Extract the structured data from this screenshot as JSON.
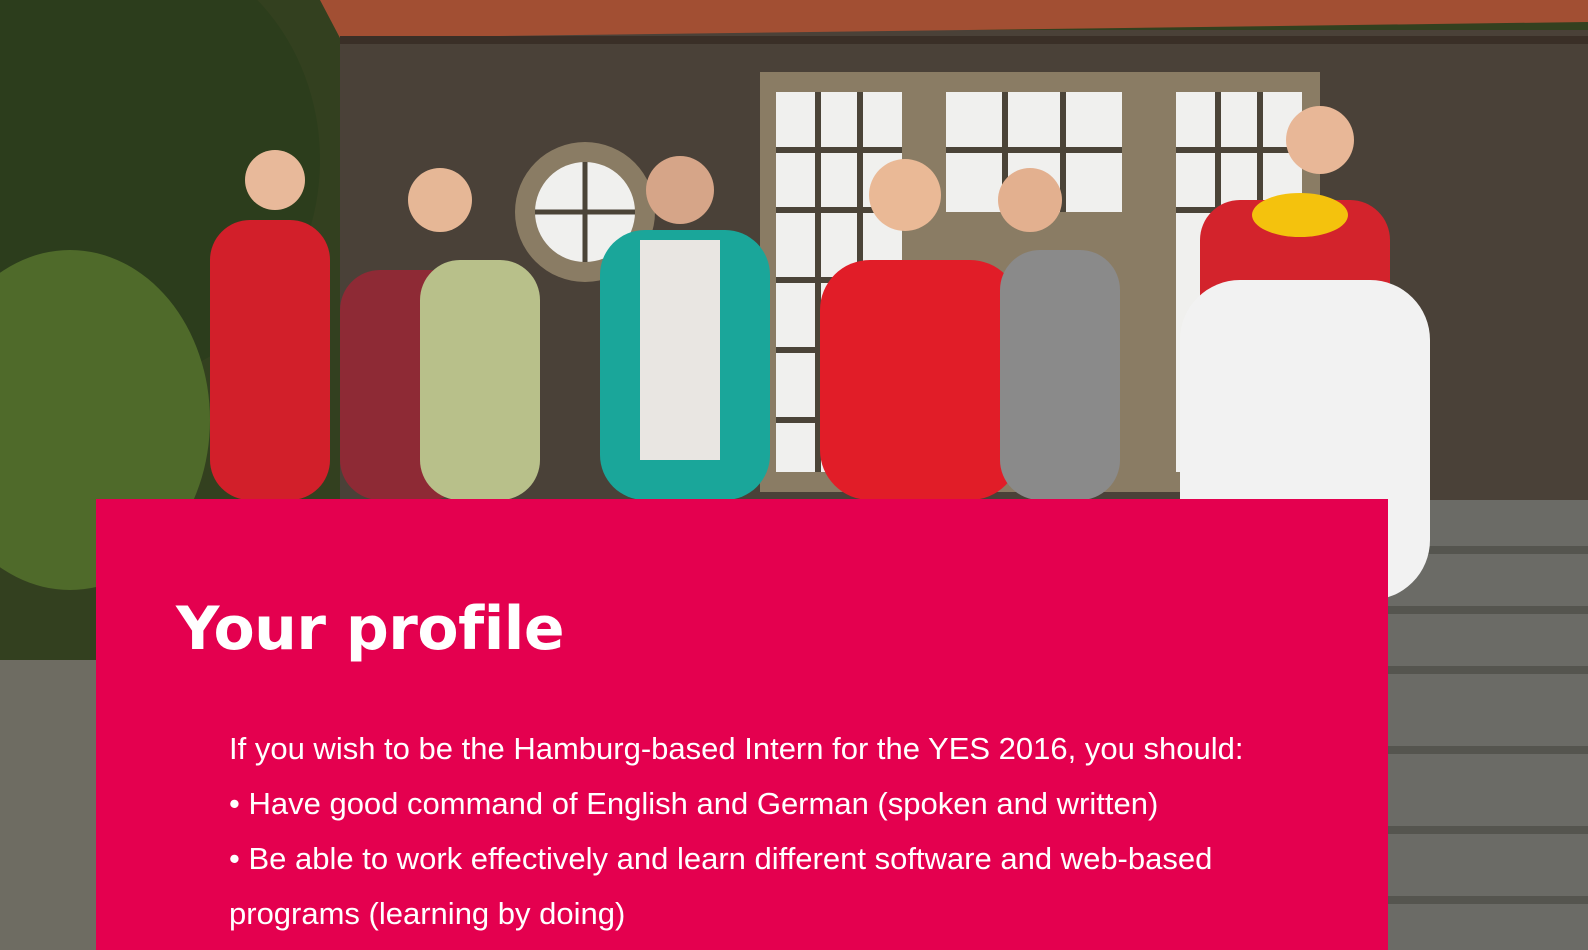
{
  "colors": {
    "card_background": "#e4004f",
    "text": "#ffffff"
  },
  "hero": {
    "image": "group-photo"
  },
  "profile": {
    "title": "Your profile",
    "intro": "If you wish to be the Hamburg-based Intern for the YES 2016, you should:",
    "requirements": [
      "• Have good command of English and German (spoken and written)",
      "• Be able to work effectively and learn different software and web-based programs (learning by doing)"
    ]
  }
}
